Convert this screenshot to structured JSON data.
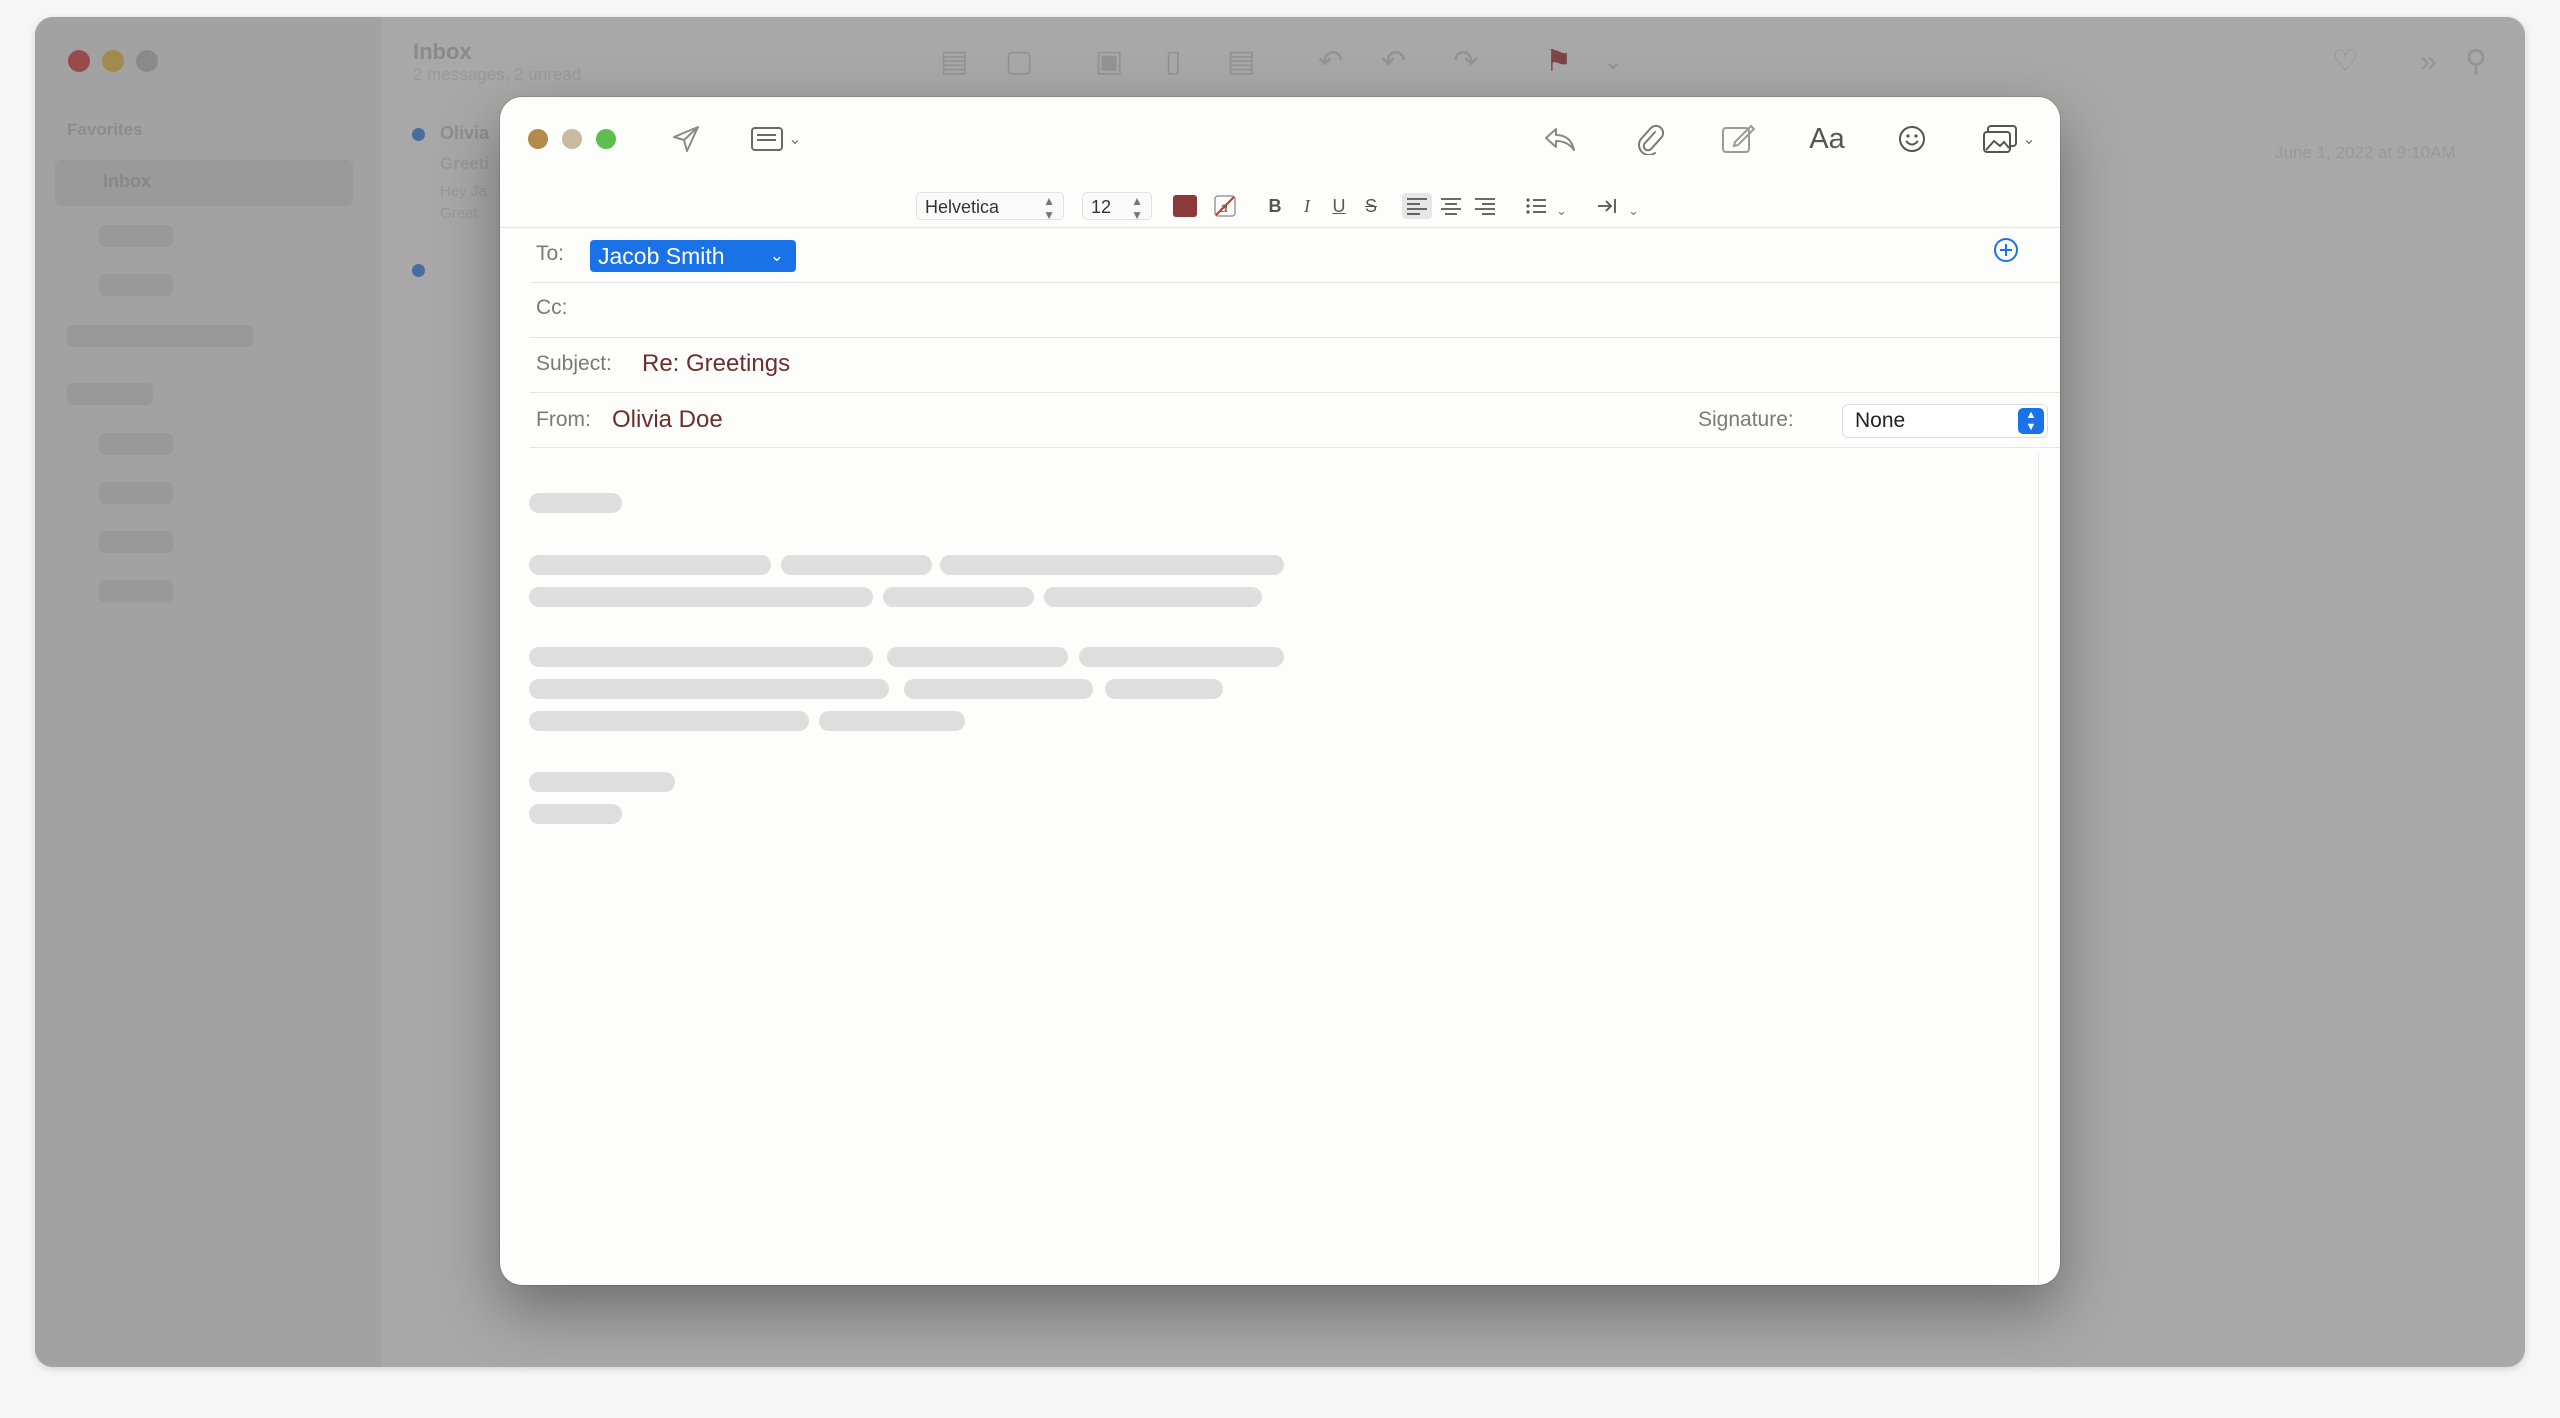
{
  "background": {
    "mailbox_title": "Inbox",
    "mailbox_subtitle": "2 messages, 2 unread",
    "sidebar_section": "Favorites",
    "sidebar_inbox": "Inbox",
    "sender": "Olivia",
    "preview_subject": "Greeti",
    "preview_line1": "Hey Ja",
    "preview_line2": "Great",
    "date": "June 1, 2022 at 9:10AM"
  },
  "compose": {
    "format": {
      "font": "Helvetica",
      "size": "12",
      "bold": "B",
      "italic": "I",
      "underline": "U",
      "strike": "S"
    },
    "to_label": "To:",
    "to_recipient": "Jacob Smith",
    "cc_label": "Cc:",
    "subject_label": "Subject:",
    "subject_value": "Re: Greetings",
    "from_label": "From:",
    "from_value": "Olivia Doe",
    "signature_label": "Signature:",
    "signature_value": "None",
    "font_button": "Aa"
  },
  "colors": {
    "accent": "#1a72e8",
    "text_color_swatch": "#8b3a3a",
    "close": "#b38a4a",
    "minimize": "#c8b9a0",
    "zoom": "#5fbf4e"
  },
  "icons": [
    "send-icon",
    "header-fields-icon",
    "reply-icon",
    "paperclip-icon",
    "markup-icon",
    "emoji-icon",
    "photo-browser-icon",
    "add-contact-icon"
  ]
}
